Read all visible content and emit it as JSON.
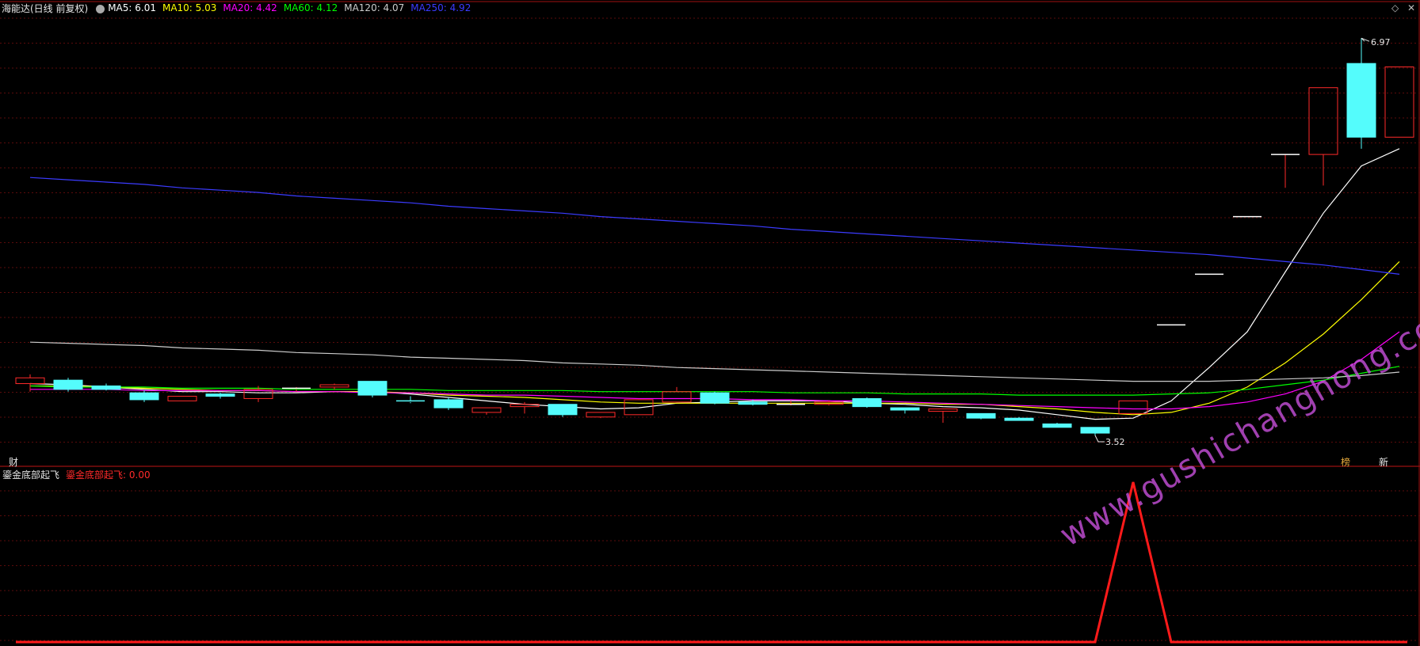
{
  "header": {
    "stock_name": "海能达(日线 前复权)",
    "indicators": [
      {
        "label": "MA5: 6.01",
        "color": "#ffffff"
      },
      {
        "label": "MA10: 5.03",
        "color": "#ffff00"
      },
      {
        "label": "MA20: 4.42",
        "color": "#ff00ff"
      },
      {
        "label": "MA60: 4.12",
        "color": "#00ff00"
      },
      {
        "label": "MA120: 4.07",
        "color": "#cccccc"
      },
      {
        "label": "MA250: 4.92",
        "color": "#3b3bff"
      }
    ]
  },
  "sub_panel": {
    "name": "鎏金底部起飞",
    "value_label": "鎏金底部起飞: 0.00",
    "value_color": "#ff2a2a"
  },
  "markers": {
    "finance_tag": "财",
    "bang_tag": "榜",
    "xin_tag": "新"
  },
  "watermark": "www.gushichanghong.com",
  "chart_data": [
    {
      "type": "candlestick",
      "title": "海能达(日线 前复权)",
      "ylim": [
        3.3,
        7.15
      ],
      "high_label": "6.97",
      "low_label": "3.52",
      "up_color": "#ff2a2a",
      "down_color": "#54fcfc",
      "candles": [
        {
          "o": 3.97,
          "h": 4.05,
          "l": 3.9,
          "c": 4.02
        },
        {
          "o": 4.0,
          "h": 4.02,
          "l": 3.9,
          "c": 3.92
        },
        {
          "o": 3.95,
          "h": 3.97,
          "l": 3.91,
          "c": 3.92
        },
        {
          "o": 3.89,
          "h": 3.91,
          "l": 3.81,
          "c": 3.83
        },
        {
          "o": 3.82,
          "h": 3.86,
          "l": 3.82,
          "c": 3.86
        },
        {
          "o": 3.88,
          "h": 3.89,
          "l": 3.84,
          "c": 3.86
        },
        {
          "o": 3.84,
          "h": 3.95,
          "l": 3.81,
          "c": 3.92
        },
        {
          "o": 3.92,
          "h": 3.94,
          "l": 3.9,
          "c": 3.93
        },
        {
          "o": 3.94,
          "h": 3.97,
          "l": 3.92,
          "c": 3.96
        },
        {
          "o": 3.99,
          "h": 3.99,
          "l": 3.85,
          "c": 3.87
        },
        {
          "o": 3.82,
          "h": 3.86,
          "l": 3.8,
          "c": 3.81
        },
        {
          "o": 3.83,
          "h": 3.85,
          "l": 3.74,
          "c": 3.76
        },
        {
          "o": 3.72,
          "h": 3.76,
          "l": 3.7,
          "c": 3.76
        },
        {
          "o": 3.77,
          "h": 3.81,
          "l": 3.71,
          "c": 3.79
        },
        {
          "o": 3.79,
          "h": 3.79,
          "l": 3.68,
          "c": 3.7
        },
        {
          "o": 3.68,
          "h": 3.72,
          "l": 3.67,
          "c": 3.72
        },
        {
          "o": 3.7,
          "h": 3.83,
          "l": 3.7,
          "c": 3.83
        },
        {
          "o": 3.81,
          "h": 3.94,
          "l": 3.81,
          "c": 3.9
        },
        {
          "o": 3.89,
          "h": 3.9,
          "l": 3.79,
          "c": 3.8
        },
        {
          "o": 3.81,
          "h": 3.83,
          "l": 3.78,
          "c": 3.79
        },
        {
          "o": 3.79,
          "h": 3.82,
          "l": 3.78,
          "c": 3.79
        },
        {
          "o": 3.79,
          "h": 3.82,
          "l": 3.78,
          "c": 3.81
        },
        {
          "o": 3.84,
          "h": 3.85,
          "l": 3.76,
          "c": 3.77
        },
        {
          "o": 3.76,
          "h": 3.76,
          "l": 3.71,
          "c": 3.74
        },
        {
          "o": 3.73,
          "h": 3.75,
          "l": 3.63,
          "c": 3.75
        },
        {
          "o": 3.71,
          "h": 3.71,
          "l": 3.66,
          "c": 3.67
        },
        {
          "o": 3.67,
          "h": 3.68,
          "l": 3.65,
          "c": 3.65
        },
        {
          "o": 3.62,
          "h": 3.63,
          "l": 3.59,
          "c": 3.59
        },
        {
          "o": 3.59,
          "h": 3.59,
          "l": 3.52,
          "c": 3.54
        },
        {
          "o": 3.71,
          "h": 3.82,
          "l": 3.71,
          "c": 3.82
        },
        {
          "o": 4.48,
          "h": 4.48,
          "l": 4.48,
          "c": 4.48
        },
        {
          "o": 4.92,
          "h": 4.92,
          "l": 4.92,
          "c": 4.92
        },
        {
          "o": 5.42,
          "h": 5.42,
          "l": 5.42,
          "c": 5.42
        },
        {
          "o": 5.96,
          "h": 5.96,
          "l": 5.67,
          "c": 5.96
        },
        {
          "o": 5.96,
          "h": 6.54,
          "l": 5.69,
          "c": 6.54
        },
        {
          "o": 6.75,
          "h": 6.97,
          "l": 6.01,
          "c": 6.11
        },
        {
          "o": 6.11,
          "h": 6.72,
          "l": 6.11,
          "c": 6.72
        }
      ],
      "moving_averages": [
        {
          "name": "MA5",
          "color": "#ffffff",
          "values": [
            3.97,
            3.96,
            3.94,
            3.92,
            3.9,
            3.9,
            3.89,
            3.89,
            3.9,
            3.9,
            3.88,
            3.85,
            3.82,
            3.79,
            3.77,
            3.75,
            3.76,
            3.8,
            3.81,
            3.82,
            3.82,
            3.82,
            3.8,
            3.79,
            3.77,
            3.76,
            3.74,
            3.7,
            3.66,
            3.67,
            3.82,
            4.11,
            4.42,
            4.94,
            5.45,
            5.86,
            6.01
          ]
        },
        {
          "name": "MA10",
          "color": "#ffff00",
          "values": [
            3.95,
            3.95,
            3.94,
            3.93,
            3.92,
            3.91,
            3.91,
            3.9,
            3.9,
            3.9,
            3.89,
            3.87,
            3.86,
            3.85,
            3.83,
            3.81,
            3.8,
            3.8,
            3.8,
            3.8,
            3.8,
            3.8,
            3.8,
            3.8,
            3.79,
            3.79,
            3.77,
            3.75,
            3.72,
            3.7,
            3.72,
            3.8,
            3.94,
            4.15,
            4.4,
            4.7,
            5.03
          ]
        },
        {
          "name": "MA20",
          "color": "#ff00ff",
          "values": [
            3.92,
            3.92,
            3.92,
            3.91,
            3.91,
            3.91,
            3.91,
            3.9,
            3.9,
            3.89,
            3.89,
            3.88,
            3.87,
            3.87,
            3.86,
            3.85,
            3.84,
            3.84,
            3.84,
            3.83,
            3.83,
            3.82,
            3.82,
            3.81,
            3.8,
            3.79,
            3.78,
            3.77,
            3.76,
            3.75,
            3.75,
            3.77,
            3.81,
            3.88,
            3.99,
            4.18,
            4.42
          ]
        },
        {
          "name": "MA60",
          "color": "#00ff00",
          "values": [
            3.95,
            3.94,
            3.94,
            3.94,
            3.93,
            3.93,
            3.93,
            3.92,
            3.92,
            3.92,
            3.92,
            3.91,
            3.91,
            3.91,
            3.91,
            3.9,
            3.9,
            3.9,
            3.9,
            3.9,
            3.89,
            3.89,
            3.89,
            3.88,
            3.88,
            3.88,
            3.87,
            3.87,
            3.87,
            3.87,
            3.88,
            3.89,
            3.92,
            3.96,
            4.0,
            4.06,
            4.12
          ]
        },
        {
          "name": "MA120",
          "color": "#cccccc",
          "values": [
            4.33,
            4.32,
            4.31,
            4.3,
            4.28,
            4.27,
            4.26,
            4.24,
            4.23,
            4.22,
            4.2,
            4.19,
            4.18,
            4.17,
            4.15,
            4.14,
            4.13,
            4.11,
            4.1,
            4.09,
            4.08,
            4.07,
            4.06,
            4.05,
            4.04,
            4.03,
            4.02,
            4.01,
            4.0,
            3.99,
            3.99,
            3.99,
            4.0,
            4.01,
            4.02,
            4.04,
            4.07
          ]
        },
        {
          "name": "MA250",
          "color": "#3b3bff",
          "values": [
            5.76,
            5.74,
            5.72,
            5.7,
            5.67,
            5.65,
            5.63,
            5.6,
            5.58,
            5.56,
            5.54,
            5.51,
            5.49,
            5.47,
            5.45,
            5.42,
            5.4,
            5.38,
            5.36,
            5.34,
            5.31,
            5.29,
            5.27,
            5.25,
            5.23,
            5.21,
            5.19,
            5.17,
            5.15,
            5.13,
            5.11,
            5.09,
            5.06,
            5.03,
            5.0,
            4.96,
            4.92
          ]
        }
      ]
    },
    {
      "type": "line",
      "title": "鎏金底部起飞",
      "ylim": [
        0,
        1
      ],
      "series": [
        {
          "name": "鎏金底部起飞",
          "color": "#ff1a1a",
          "values": [
            0,
            0,
            0,
            0,
            0,
            0,
            0,
            0,
            0,
            0,
            0,
            0,
            0,
            0,
            0,
            0,
            0,
            0,
            0,
            0,
            0,
            0,
            0,
            0,
            0,
            0,
            0,
            0,
            0,
            1,
            0,
            0,
            0,
            0,
            0,
            0,
            0
          ]
        }
      ]
    }
  ]
}
